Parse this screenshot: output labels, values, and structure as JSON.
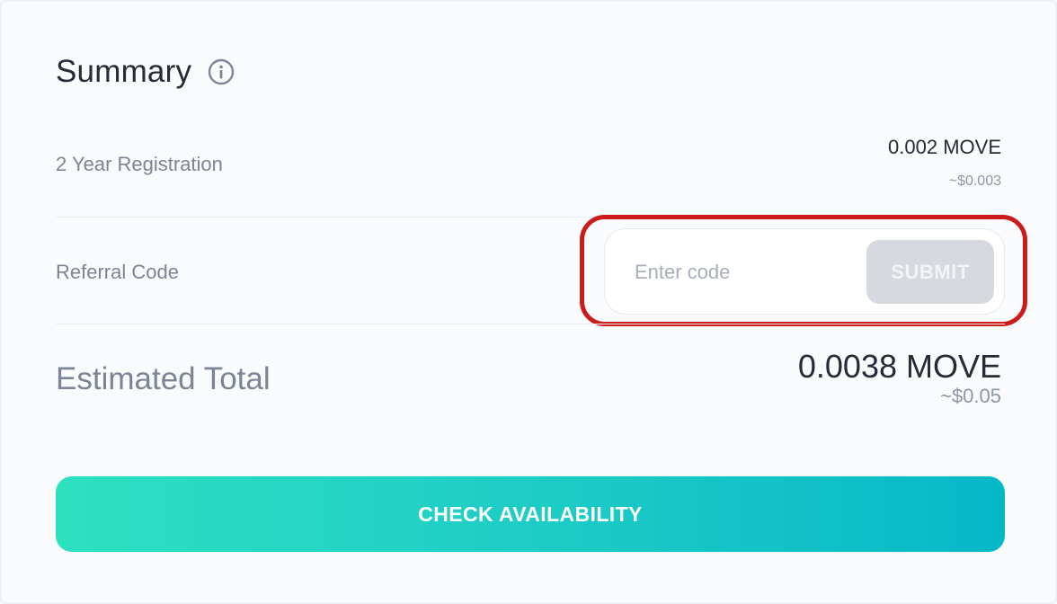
{
  "summary": {
    "title": "Summary",
    "info_icon": "info-circle-icon"
  },
  "registration": {
    "label": "2 Year Registration",
    "price": "0.002 MOVE",
    "usd": "~$0.003"
  },
  "referral": {
    "label": "Referral Code",
    "placeholder": "Enter code",
    "value": "",
    "submit_label": "SUBMIT"
  },
  "total": {
    "label": "Estimated Total",
    "price": "0.0038 MOVE",
    "usd": "~$0.05"
  },
  "cta": {
    "label": "CHECK AVAILABILITY"
  },
  "colors": {
    "accent_start": "#2de0bf",
    "accent_end": "#06b8c7",
    "highlight": "#cc1b1b",
    "submit_disabled": "#d6d9de"
  }
}
